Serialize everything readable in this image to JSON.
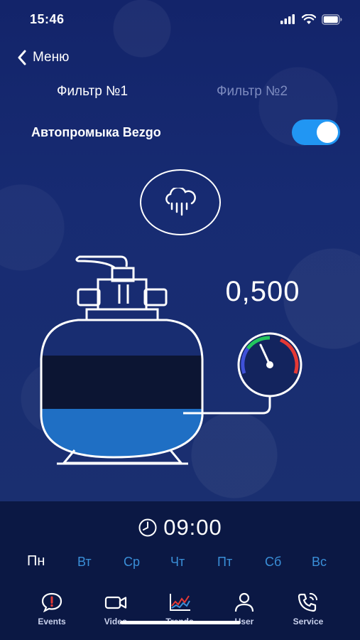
{
  "status_bar": {
    "time": "15:46"
  },
  "nav": {
    "back_label": "Меню"
  },
  "filter_tabs": [
    {
      "label": "Фильтр №1",
      "active": true
    },
    {
      "label": "Фильтр №2",
      "active": false
    }
  ],
  "auto_wash": {
    "label": "Автопромыка Bezgo",
    "enabled": true
  },
  "wash_button": {
    "icon": "rain-cloud-icon"
  },
  "filter": {
    "pressure_value": "0,500"
  },
  "schedule": {
    "time": "09:00",
    "days": [
      {
        "label": "Пн",
        "active": true
      },
      {
        "label": "Вт",
        "active": false
      },
      {
        "label": "Ср",
        "active": false
      },
      {
        "label": "Чт",
        "active": false
      },
      {
        "label": "Пт",
        "active": false
      },
      {
        "label": "Сб",
        "active": false
      },
      {
        "label": "Вс",
        "active": false
      }
    ]
  },
  "tab_bar": [
    {
      "label": "Events",
      "icon": "alert-bubble-icon"
    },
    {
      "label": "Video",
      "icon": "video-camera-icon"
    },
    {
      "label": "Trends",
      "icon": "trend-chart-icon"
    },
    {
      "label": "User",
      "icon": "user-icon"
    },
    {
      "label": "Service",
      "icon": "phone-service-icon"
    }
  ],
  "colors": {
    "background": "#13245e",
    "bottom_panel": "#0b1844",
    "accent_blue": "#2196f3",
    "water": "#1f6fc4",
    "gauge_green": "#22c55e",
    "gauge_red": "#e53935",
    "gauge_blue": "#3f51d8"
  }
}
